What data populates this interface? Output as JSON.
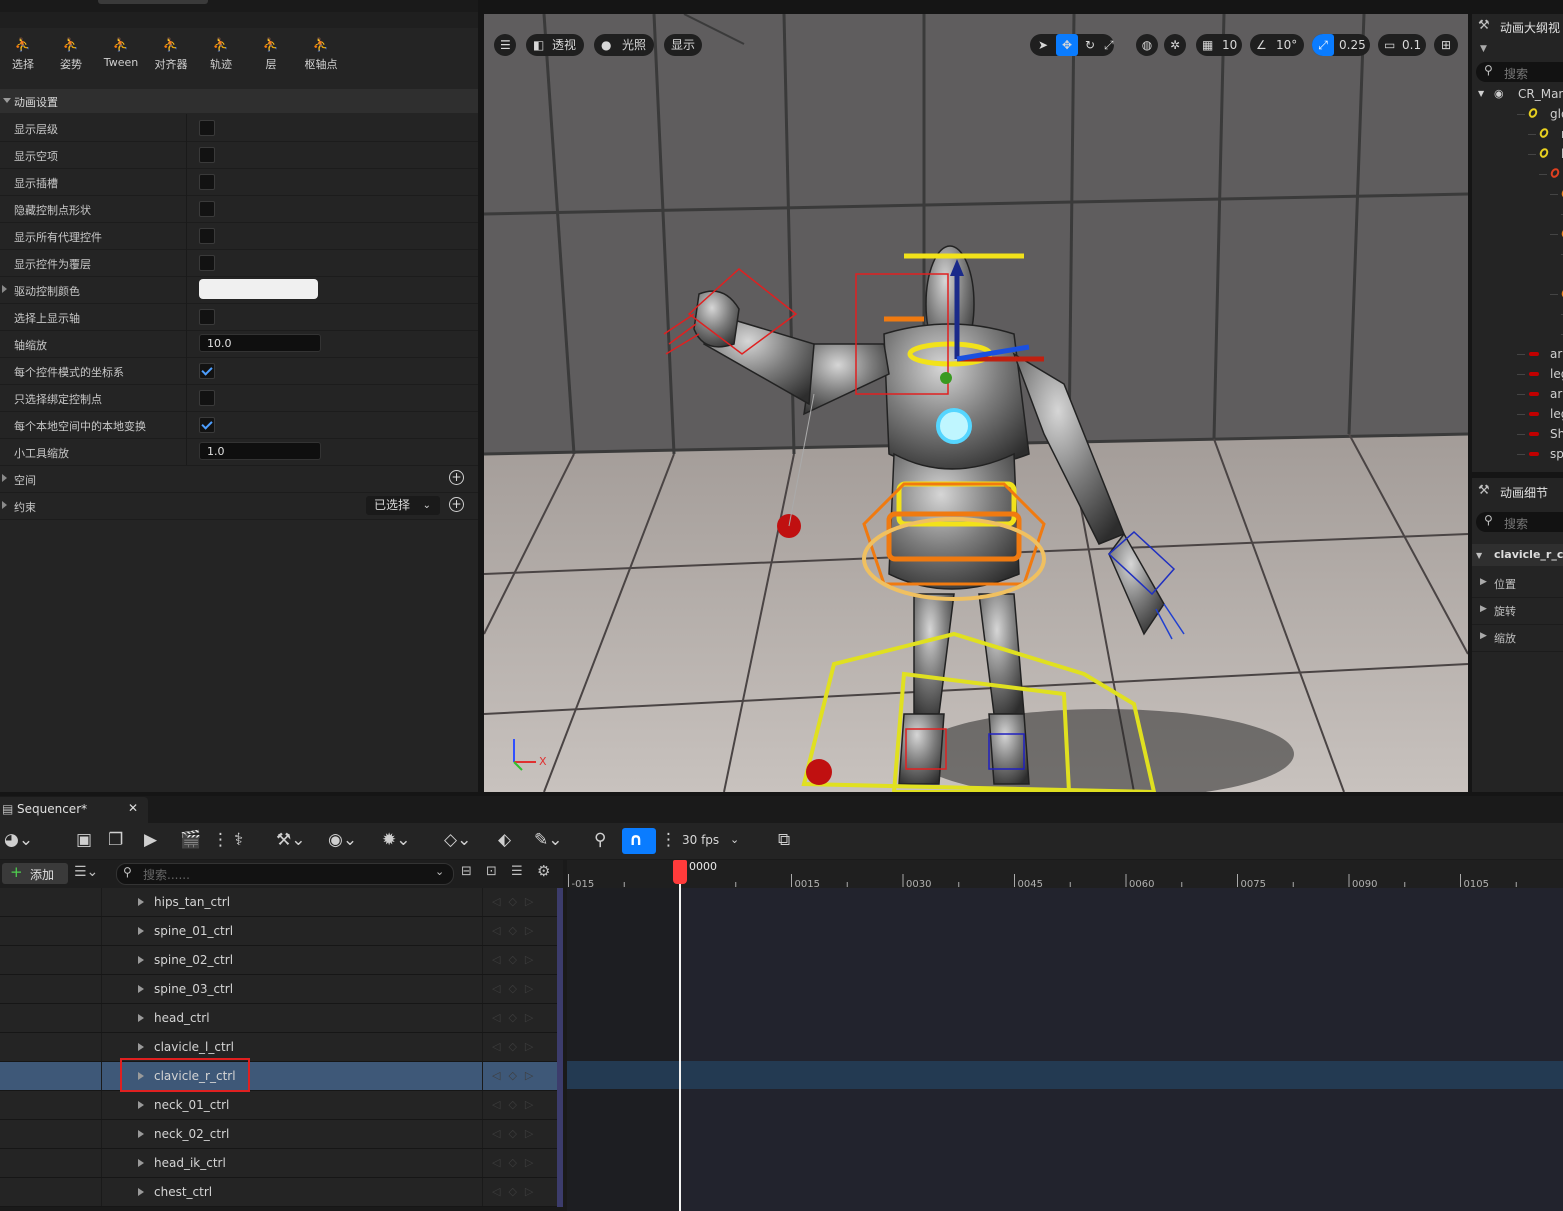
{
  "mode_toolbar": [
    {
      "label": "选择",
      "icon": "select-icon"
    },
    {
      "label": "姿势",
      "icon": "pose-icon"
    },
    {
      "label": "Tween",
      "icon": "tween-icon"
    },
    {
      "label": "对齐器",
      "icon": "aligner-icon"
    },
    {
      "label": "轨迹",
      "icon": "trails-icon"
    },
    {
      "label": "层",
      "icon": "layers-icon"
    },
    {
      "label": "枢轴点",
      "icon": "pivot-icon"
    }
  ],
  "anim_settings": {
    "title": "动画设置",
    "rows": [
      {
        "label": "显示层级",
        "type": "checkbox",
        "checked": false
      },
      {
        "label": "显示空项",
        "type": "checkbox",
        "checked": false
      },
      {
        "label": "显示插槽",
        "type": "checkbox",
        "checked": false
      },
      {
        "label": "隐藏控制点形状",
        "type": "checkbox",
        "checked": false
      },
      {
        "label": "显示所有代理控件",
        "type": "checkbox",
        "checked": false
      },
      {
        "label": "显示控件为覆层",
        "type": "checkbox",
        "checked": false
      },
      {
        "label": "驱动控制颜色",
        "type": "color",
        "value": "#f0f0f0"
      },
      {
        "label": "选择上显示轴",
        "type": "checkbox",
        "checked": false
      },
      {
        "label": "轴缩放",
        "type": "number",
        "value": "10.0"
      },
      {
        "label": "每个控件模式的坐标系",
        "type": "checkbox",
        "checked": true
      },
      {
        "label": "只选择绑定控制点",
        "type": "checkbox",
        "checked": false
      },
      {
        "label": "每个本地空间中的本地变换",
        "type": "checkbox",
        "checked": true
      },
      {
        "label": "小工具缩放",
        "type": "number",
        "value": "1.0"
      }
    ],
    "space_label": "空间",
    "constraint_label": "约束",
    "constraint_dropdown": "已选择"
  },
  "viewport": {
    "perspective": "透视",
    "lighting": "光照",
    "show": "显示",
    "grid_size": "10",
    "rotation_snap": "10°",
    "scale_snap": "0.25",
    "camera_speed": "0.1",
    "axis_x": "X"
  },
  "outliner": {
    "title": "动画大纲视",
    "search_placeholder": "搜索",
    "items": [
      {
        "text": "CR_Man",
        "indent": 0,
        "kind": "eye"
      },
      {
        "text": "global",
        "indent": 1,
        "kind": "yellow"
      },
      {
        "text": "root",
        "indent": 2,
        "kind": "yellow"
      },
      {
        "text": "body",
        "indent": 2,
        "kind": "yellow"
      },
      {
        "text": "bo",
        "indent": 3,
        "kind": "red-ring"
      },
      {
        "text": "h",
        "indent": 4,
        "kind": "orange"
      },
      {
        "text": "",
        "indent": 5,
        "kind": "yellow"
      },
      {
        "text": "s",
        "indent": 4,
        "kind": "orange"
      },
      {
        "text": "",
        "indent": 5,
        "kind": "orange"
      },
      {
        "text": "",
        "indent": 6,
        "kind": "yellow"
      },
      {
        "text": "c",
        "indent": 4,
        "kind": "orange"
      },
      {
        "text": "",
        "indent": 5,
        "kind": "yellow"
      },
      {
        "text": "",
        "indent": 5,
        "kind": "red"
      },
      {
        "text": "arm_",
        "indent": 1,
        "kind": "red"
      },
      {
        "text": "leg_",
        "indent": 1,
        "kind": "red"
      },
      {
        "text": "arm_",
        "indent": 1,
        "kind": "red"
      },
      {
        "text": "leg_",
        "indent": 1,
        "kind": "red"
      },
      {
        "text": "Shov",
        "indent": 1,
        "kind": "red"
      },
      {
        "text": "spin",
        "indent": 1,
        "kind": "red"
      }
    ]
  },
  "details": {
    "title": "动画细节",
    "search_placeholder": "搜索",
    "selected": "clavicle_r_ctrl",
    "sections": [
      "位置",
      "旋转",
      "缩放"
    ]
  },
  "sequencer": {
    "tab_title": "Sequencer*",
    "add_label": "添加",
    "search_placeholder": "搜索......",
    "fps": "30 fps",
    "current_frame": "0000",
    "ticks": [
      "-015",
      "0015",
      "0030",
      "0045",
      "0060",
      "0075",
      "0090",
      "0105"
    ],
    "tracks": [
      "hips_tan_ctrl",
      "spine_01_ctrl",
      "spine_02_ctrl",
      "spine_03_ctrl",
      "head_ctrl",
      "clavicle_l_ctrl",
      "clavicle_r_ctrl",
      "neck_01_ctrl",
      "neck_02_ctrl",
      "head_ik_ctrl",
      "chest_ctrl"
    ],
    "selected_track": "clavicle_r_ctrl"
  },
  "colors": {
    "accent": "#0a7cff",
    "selected_row": "#3e5878",
    "playhead": "#ff3b3b",
    "gizmo_yellow": "#f2e21a",
    "gizmo_orange": "#f07a10"
  }
}
